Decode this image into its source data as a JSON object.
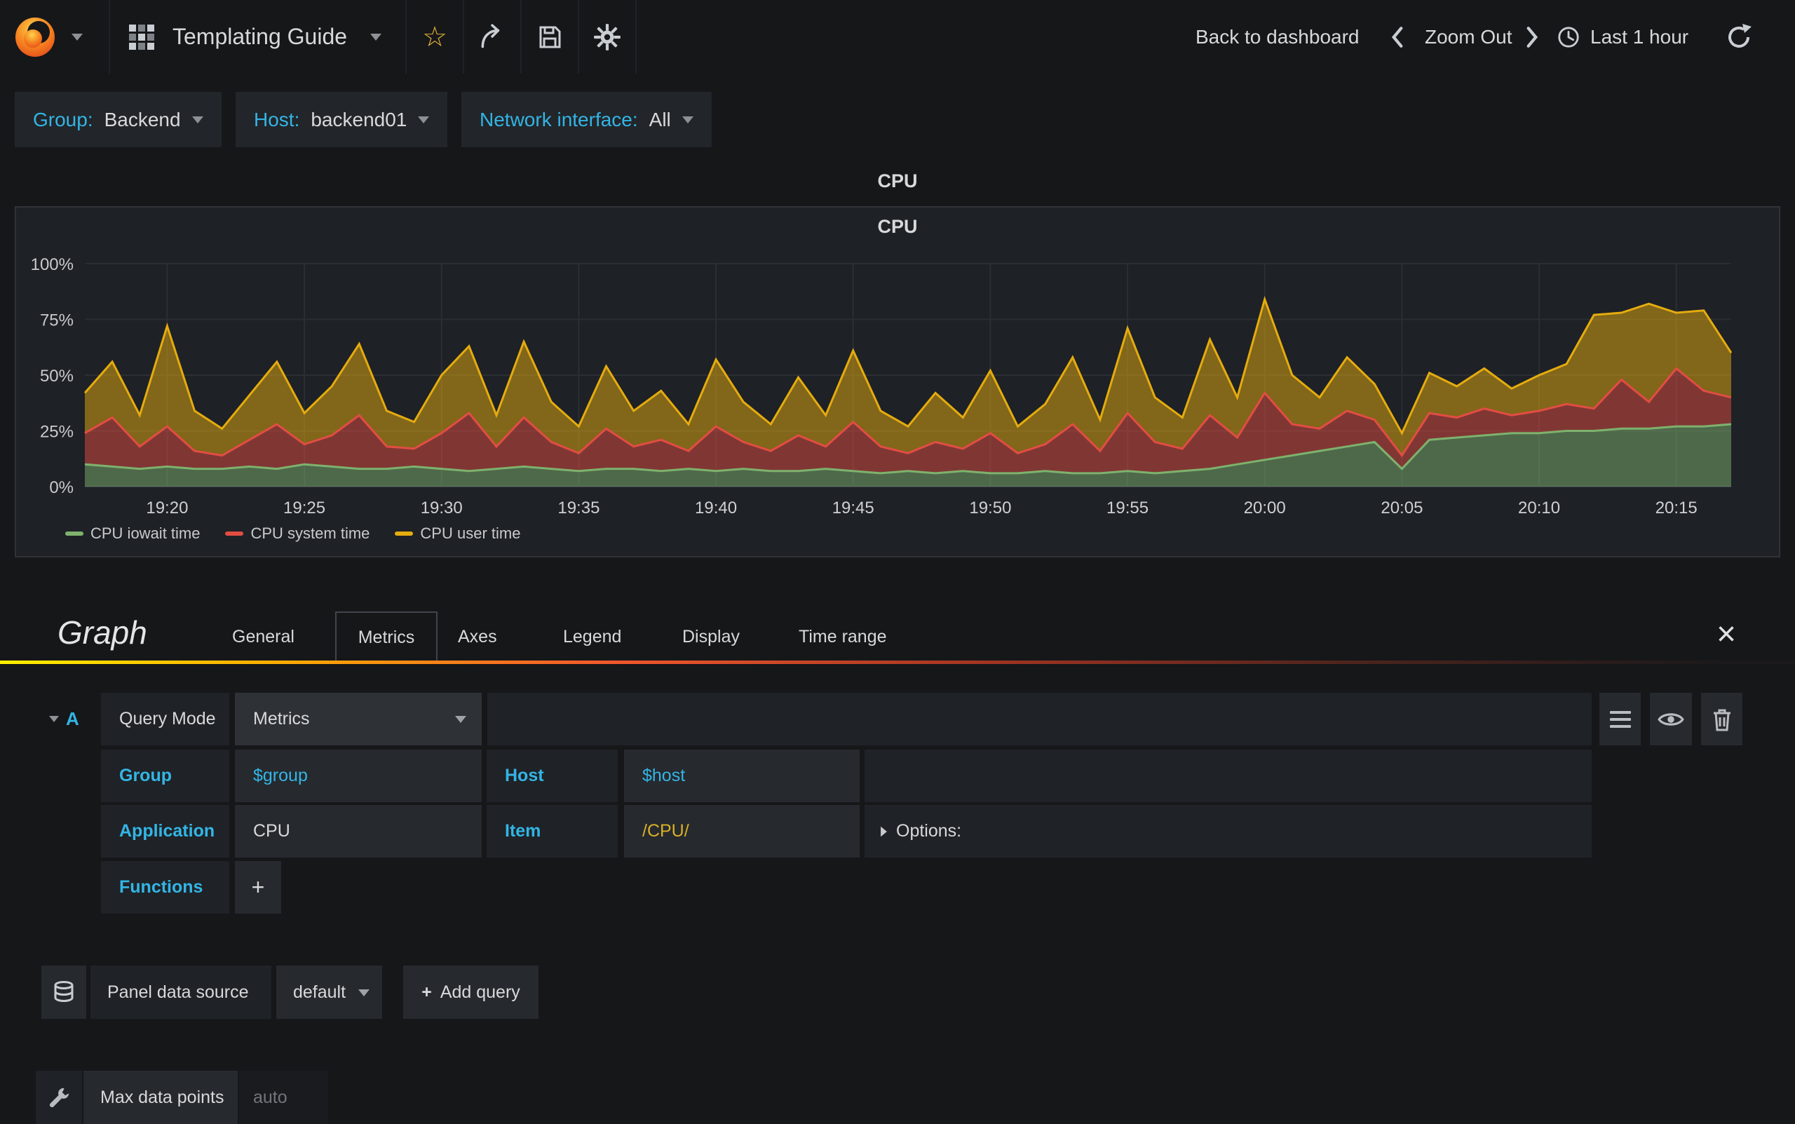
{
  "navbar": {
    "title": "Templating Guide",
    "back_to_dashboard": "Back to dashboard",
    "zoom_out": "Zoom Out",
    "time_range": "Last 1 hour"
  },
  "icons": {
    "star": "☆",
    "close": "×",
    "plus": "+"
  },
  "variables": [
    {
      "label": "Group:",
      "value": "Backend"
    },
    {
      "label": "Host:",
      "value": "backend01"
    },
    {
      "label": "Network interface:",
      "value": "All"
    }
  ],
  "panel": {
    "row_title": "CPU",
    "title": "CPU"
  },
  "chart_data": {
    "type": "area",
    "stacked": true,
    "title": "CPU",
    "x_min": 0,
    "x_max": 60,
    "ylim": [
      0,
      100
    ],
    "yticks": [
      0,
      25,
      50,
      75,
      100
    ],
    "ytick_labels": [
      "0%",
      "25%",
      "50%",
      "75%",
      "100%"
    ],
    "xticks": [
      {
        "t": 3,
        "label": "19:20"
      },
      {
        "t": 8,
        "label": "19:25"
      },
      {
        "t": 13,
        "label": "19:30"
      },
      {
        "t": 18,
        "label": "19:35"
      },
      {
        "t": 23,
        "label": "19:40"
      },
      {
        "t": 28,
        "label": "19:45"
      },
      {
        "t": 33,
        "label": "19:50"
      },
      {
        "t": 38,
        "label": "19:55"
      },
      {
        "t": 43,
        "label": "20:00"
      },
      {
        "t": 48,
        "label": "20:05"
      },
      {
        "t": 53,
        "label": "20:10"
      },
      {
        "t": 58,
        "label": "20:15"
      }
    ],
    "legend_position": "bottom-left",
    "grid": true,
    "series": [
      {
        "name": "CPU iowait time",
        "color": "#7EB26D",
        "fill_opacity": 0.5,
        "values": [
          10,
          9,
          8,
          9,
          8,
          8,
          9,
          8,
          10,
          9,
          8,
          8,
          9,
          8,
          7,
          8,
          9,
          8,
          7,
          8,
          8,
          7,
          8,
          7,
          8,
          7,
          7,
          8,
          7,
          6,
          7,
          6,
          7,
          6,
          6,
          7,
          6,
          6,
          7,
          6,
          7,
          8,
          10,
          12,
          14,
          16,
          18,
          20,
          8,
          21,
          22,
          23,
          24,
          24,
          25,
          25,
          26,
          26,
          27,
          27,
          28
        ]
      },
      {
        "name": "CPU system time",
        "color": "#E24D42",
        "fill_opacity": 0.5,
        "values": [
          14,
          22,
          10,
          18,
          8,
          6,
          12,
          20,
          9,
          14,
          24,
          10,
          8,
          16,
          26,
          10,
          22,
          12,
          8,
          18,
          10,
          14,
          8,
          20,
          12,
          9,
          16,
          10,
          22,
          12,
          8,
          14,
          10,
          18,
          9,
          12,
          22,
          10,
          26,
          14,
          10,
          24,
          12,
          30,
          14,
          10,
          16,
          10,
          6,
          12,
          9,
          12,
          8,
          10,
          12,
          10,
          22,
          12,
          26,
          16,
          12
        ]
      },
      {
        "name": "CPU user time",
        "color": "#E5AC0E",
        "fill_opacity": 0.5,
        "values": [
          18,
          25,
          14,
          45,
          18,
          12,
          20,
          28,
          14,
          22,
          32,
          16,
          12,
          26,
          30,
          14,
          34,
          18,
          12,
          28,
          16,
          22,
          12,
          30,
          18,
          12,
          26,
          14,
          32,
          16,
          12,
          22,
          14,
          28,
          12,
          18,
          30,
          14,
          38,
          20,
          14,
          34,
          18,
          42,
          22,
          14,
          24,
          16,
          10,
          18,
          14,
          18,
          12,
          16,
          18,
          42,
          30,
          44,
          25,
          36,
          20
        ]
      }
    ]
  },
  "editor": {
    "panel_type_label": "Graph",
    "tabs": [
      "General",
      "Metrics",
      "Axes",
      "Legend",
      "Display",
      "Time range"
    ],
    "active_tab": "Metrics",
    "query": {
      "ref_id": "A",
      "mode_label": "Query Mode",
      "mode_value": "Metrics",
      "group_label": "Group",
      "group_value": "$group",
      "host_label": "Host",
      "host_value": "$host",
      "application_label": "Application",
      "application_value": "CPU",
      "item_label": "Item",
      "item_value": "/CPU/",
      "options_label": "Options:",
      "functions_label": "Functions"
    },
    "datasource": {
      "label": "Panel data source",
      "value": "default",
      "add_query_label": "Add query"
    },
    "max_data_points": {
      "label": "Max data points",
      "placeholder": "auto"
    }
  }
}
